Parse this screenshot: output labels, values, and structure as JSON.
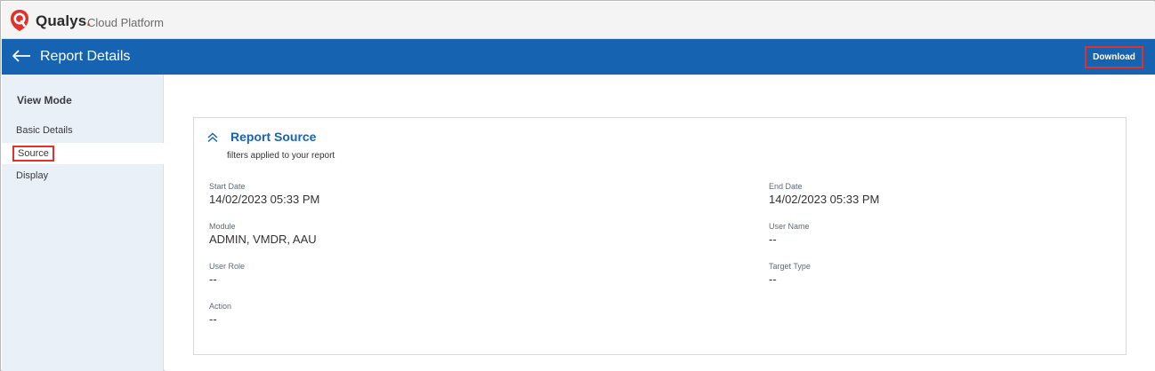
{
  "brand": {
    "name": "Qualys",
    "dot": ".",
    "subtitle": "Cloud Platform",
    "logo_icon": "qualys-shield-icon",
    "accent": "#e0312b"
  },
  "header": {
    "title": "Report Details",
    "back_icon": "arrow-left-icon",
    "download_label": "Download",
    "background": "#1563b1"
  },
  "sidebar": {
    "heading": "View Mode",
    "items": [
      {
        "label": "Basic Details",
        "selected": false
      },
      {
        "label": "Source",
        "selected": true
      },
      {
        "label": "Display",
        "selected": false
      }
    ]
  },
  "report_source": {
    "title": "Report Source",
    "subtitle": "filters applied to your report",
    "collapse_icon": "chevron-double-up-icon",
    "fields": {
      "start_date": {
        "label": "Start Date",
        "value": "14/02/2023 05:33 PM"
      },
      "end_date": {
        "label": "End Date",
        "value": "14/02/2023 05:33 PM"
      },
      "module": {
        "label": "Module",
        "value": "ADMIN, VMDR, AAU"
      },
      "user_name": {
        "label": "User Name",
        "value": "--"
      },
      "user_role": {
        "label": "User Role",
        "value": "--"
      },
      "target_type": {
        "label": "Target Type",
        "value": "--"
      },
      "action": {
        "label": "Action",
        "value": "--"
      }
    }
  }
}
